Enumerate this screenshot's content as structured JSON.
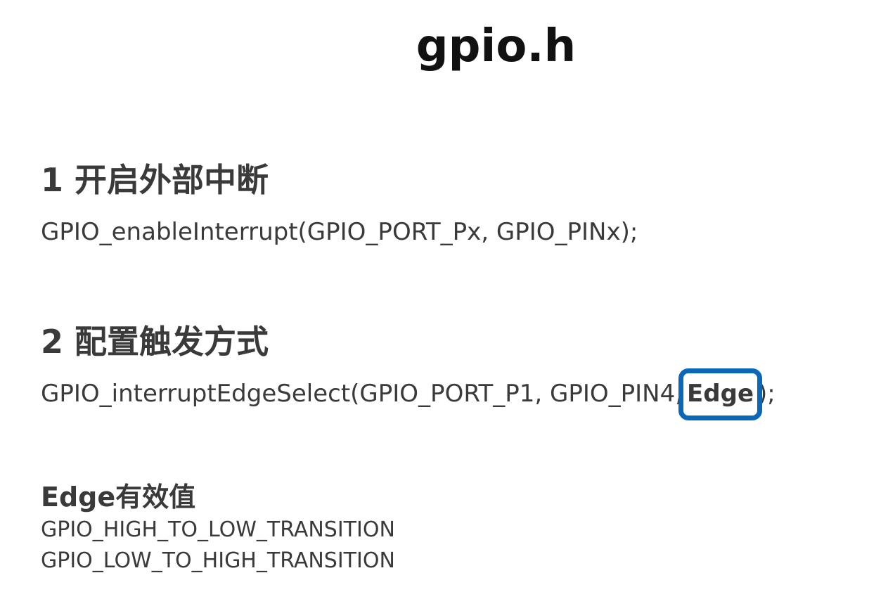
{
  "page": {
    "title": "gpio.h"
  },
  "section1": {
    "heading": "1 开启外部中断",
    "code": "GPIO_enableInterrupt(GPIO_PORT_Px, GPIO_PINx);"
  },
  "section2": {
    "heading": "2 配置触发方式",
    "code_prefix": "GPIO_interruptEdgeSelect(GPIO_PORT_P1, GPIO_PIN4,",
    "code_highlight": "Edge",
    "code_suffix": ");",
    "highlight_color": "#0b68b8"
  },
  "edge_values": {
    "heading": "Edge有效值",
    "items": [
      "GPIO_HIGH_TO_LOW_TRANSITION",
      "GPIO_LOW_TO_HIGH_TRANSITION"
    ]
  }
}
